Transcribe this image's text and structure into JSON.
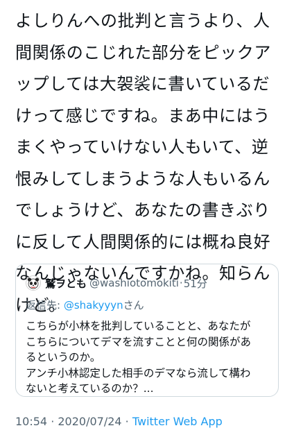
{
  "tweet": {
    "lines": [
      "よしりんへの批判と言うより、人",
      "間関係のこじれた部分をピックア",
      "ップしては大袈裟に書いているだ",
      "けって感じですね。まあ中にはう",
      "まくやっていけない人もいて、逆",
      "恨みしてしまうような人もいるん",
      "でしょうけど、あなたの書きぶり",
      "に反して人間関係的には概ね良好",
      "なんじゃないんですかね。知らん",
      "けど。"
    ]
  },
  "quote": {
    "avatar_icon": "panda-avatar-icon",
    "name": "鷲ヲとも",
    "handle": "@washiotomokiti",
    "separator": "·",
    "time": "51分",
    "reply_prefix": "返信先: ",
    "reply_handle": "@shakyyyn",
    "reply_suffix": "さん",
    "lines": [
      "こちらが小林を批判していることと、あなたが",
      "こちらについてデマを流すことと何の関係があ",
      "るというのか。",
      "アンチ小林認定した相手のデマなら流して構わ",
      "ないと考えているのか？..."
    ]
  },
  "meta": {
    "time": "10:54",
    "separator1": " · ",
    "date": "2020/07/24",
    "separator2": " · ",
    "source": "Twitter Web App"
  },
  "colors": {
    "text": "#0f1419",
    "secondary": "#536471",
    "link": "#1d9bf0",
    "border": "#cfd9de"
  }
}
